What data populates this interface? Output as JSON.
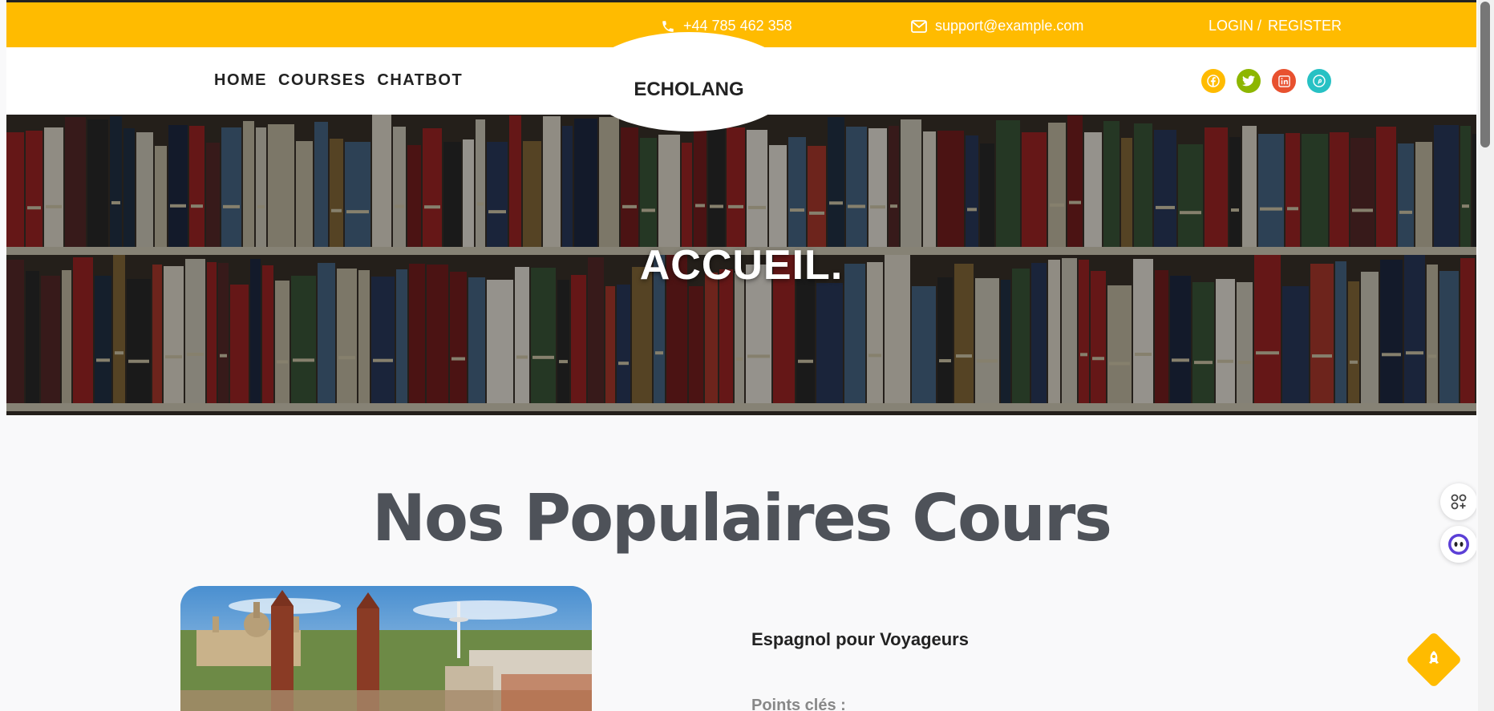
{
  "topbar": {
    "phone": "+44 785 462 358",
    "email": "support@example.com",
    "login": "LOGIN /",
    "register": "REGISTER",
    "background": "#ffbb00"
  },
  "nav": {
    "items": [
      "HOME",
      "COURSES",
      "CHATBOT"
    ],
    "logo": "ECHOLANG"
  },
  "social": [
    {
      "name": "facebook-icon",
      "color": "#ffbb00"
    },
    {
      "name": "twitter-icon",
      "color": "#8db600"
    },
    {
      "name": "linkedin-icon",
      "color": "#e8512f"
    },
    {
      "name": "pinterest-icon",
      "color": "#27c1c4"
    }
  ],
  "hero": {
    "title": "ACCUEIL."
  },
  "courses": {
    "title": "Nos Populaires Cours",
    "first": {
      "title": "Espagnol pour Voyageurs",
      "points_label": "Points clés :"
    }
  },
  "floating": {
    "apps_icon": "apps-icon",
    "assistant_icon": "assistant-face-icon",
    "scroll_top_icon": "rocket-icon"
  }
}
